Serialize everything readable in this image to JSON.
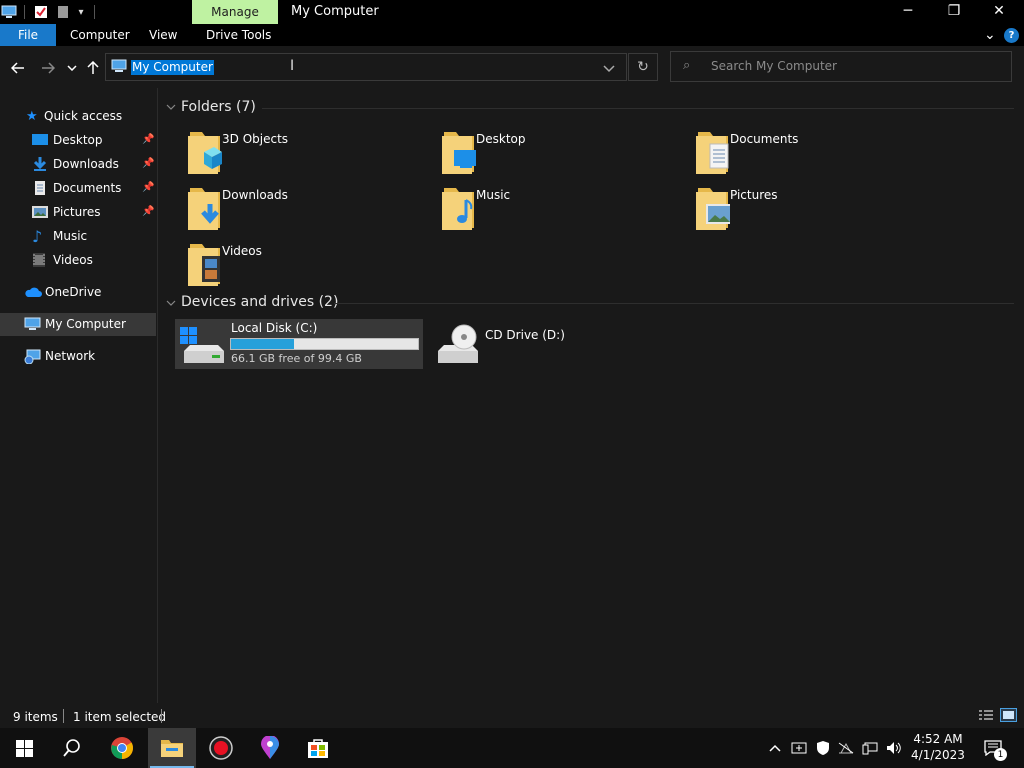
{
  "window": {
    "title": "My Computer",
    "context_tab": "Manage",
    "minimize": "─",
    "restore": "❐",
    "close": "✕"
  },
  "ribbon": {
    "file": "File",
    "tabs": [
      "Computer",
      "View",
      "Drive Tools"
    ],
    "collapse": "⌄",
    "help": "?"
  },
  "address": {
    "value": "My Computer",
    "search_placeholder": "Search My Computer"
  },
  "sidebar": {
    "quick_access": "Quick access",
    "items": [
      {
        "label": "Desktop",
        "pinned": true,
        "icon": "desktop-icon"
      },
      {
        "label": "Downloads",
        "pinned": true,
        "icon": "download-arrow-icon"
      },
      {
        "label": "Documents",
        "pinned": true,
        "icon": "document-icon"
      },
      {
        "label": "Pictures",
        "pinned": true,
        "icon": "picture-icon"
      },
      {
        "label": "Music",
        "pinned": false,
        "icon": "music-note-icon"
      },
      {
        "label": "Videos",
        "pinned": false,
        "icon": "film-icon"
      }
    ],
    "onedrive": "OneDrive",
    "my_computer": "My Computer",
    "network": "Network"
  },
  "main": {
    "folders_header": "Folders (7)",
    "folders": [
      "3D Objects",
      "Desktop",
      "Documents",
      "Downloads",
      "Music",
      "Pictures",
      "Videos"
    ],
    "devices_header": "Devices and drives (2)",
    "drives": [
      {
        "name": "Local Disk (C:)",
        "free": "66.1 GB free of 99.4 GB",
        "used_fraction": 0.335
      },
      {
        "name": "CD Drive (D:)"
      }
    ]
  },
  "status": {
    "items": "9 items",
    "selected": "1 item selected"
  },
  "taskbar": {
    "time": "4:52 AM",
    "date": "4/1/2023"
  },
  "colors": {
    "accent": "#0078d7",
    "manage_tab": "#bff2a2",
    "folder_yellow": "#f2c55c",
    "drive_bar": "#26a0da"
  }
}
